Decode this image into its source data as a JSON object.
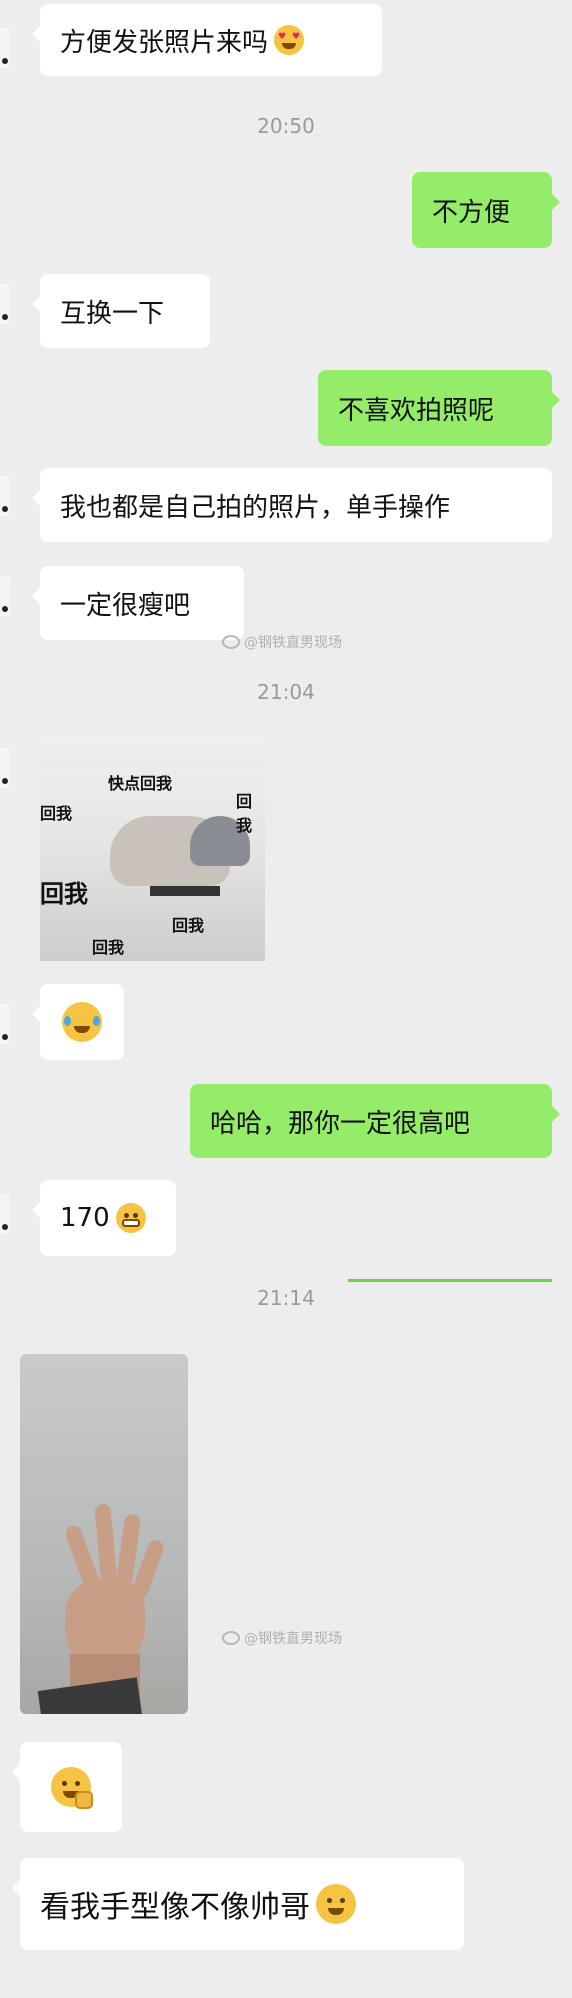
{
  "messages": [
    {
      "side": "left",
      "text": "方便发张照片来吗",
      "emoji": "heart-eyes-emoji"
    },
    {
      "type": "time",
      "text": "20:50"
    },
    {
      "side": "right",
      "text": "不方便"
    },
    {
      "side": "left",
      "text": "互换一下"
    },
    {
      "side": "right",
      "text": "不喜欢拍照呢"
    },
    {
      "side": "left",
      "text": "我也都是自己拍的照片，单手操作"
    },
    {
      "side": "left",
      "text": "一定很瘦吧"
    },
    {
      "type": "time",
      "text": "21:04"
    },
    {
      "side": "left",
      "type": "sticker",
      "captions": [
        "快点回我",
        "回我",
        "回我",
        "回我",
        "回我",
        "回我"
      ]
    },
    {
      "side": "left",
      "type": "emoji",
      "emoji": "crying-emoji"
    },
    {
      "side": "right",
      "text": "哈哈，那你一定很高吧"
    },
    {
      "side": "left",
      "text": "170",
      "emoji": "grimacing-emoji"
    },
    {
      "type": "time",
      "text": "21:14"
    },
    {
      "side": "left",
      "type": "photo",
      "emoji": "hand-photo"
    },
    {
      "side": "left",
      "type": "emoji",
      "emoji": "shy-salute-emoji"
    },
    {
      "side": "left",
      "text": "看我手型像不像帅哥",
      "emoji": "smiling-emoji"
    }
  ],
  "watermark": {
    "text": "@钢铁直男现场"
  }
}
